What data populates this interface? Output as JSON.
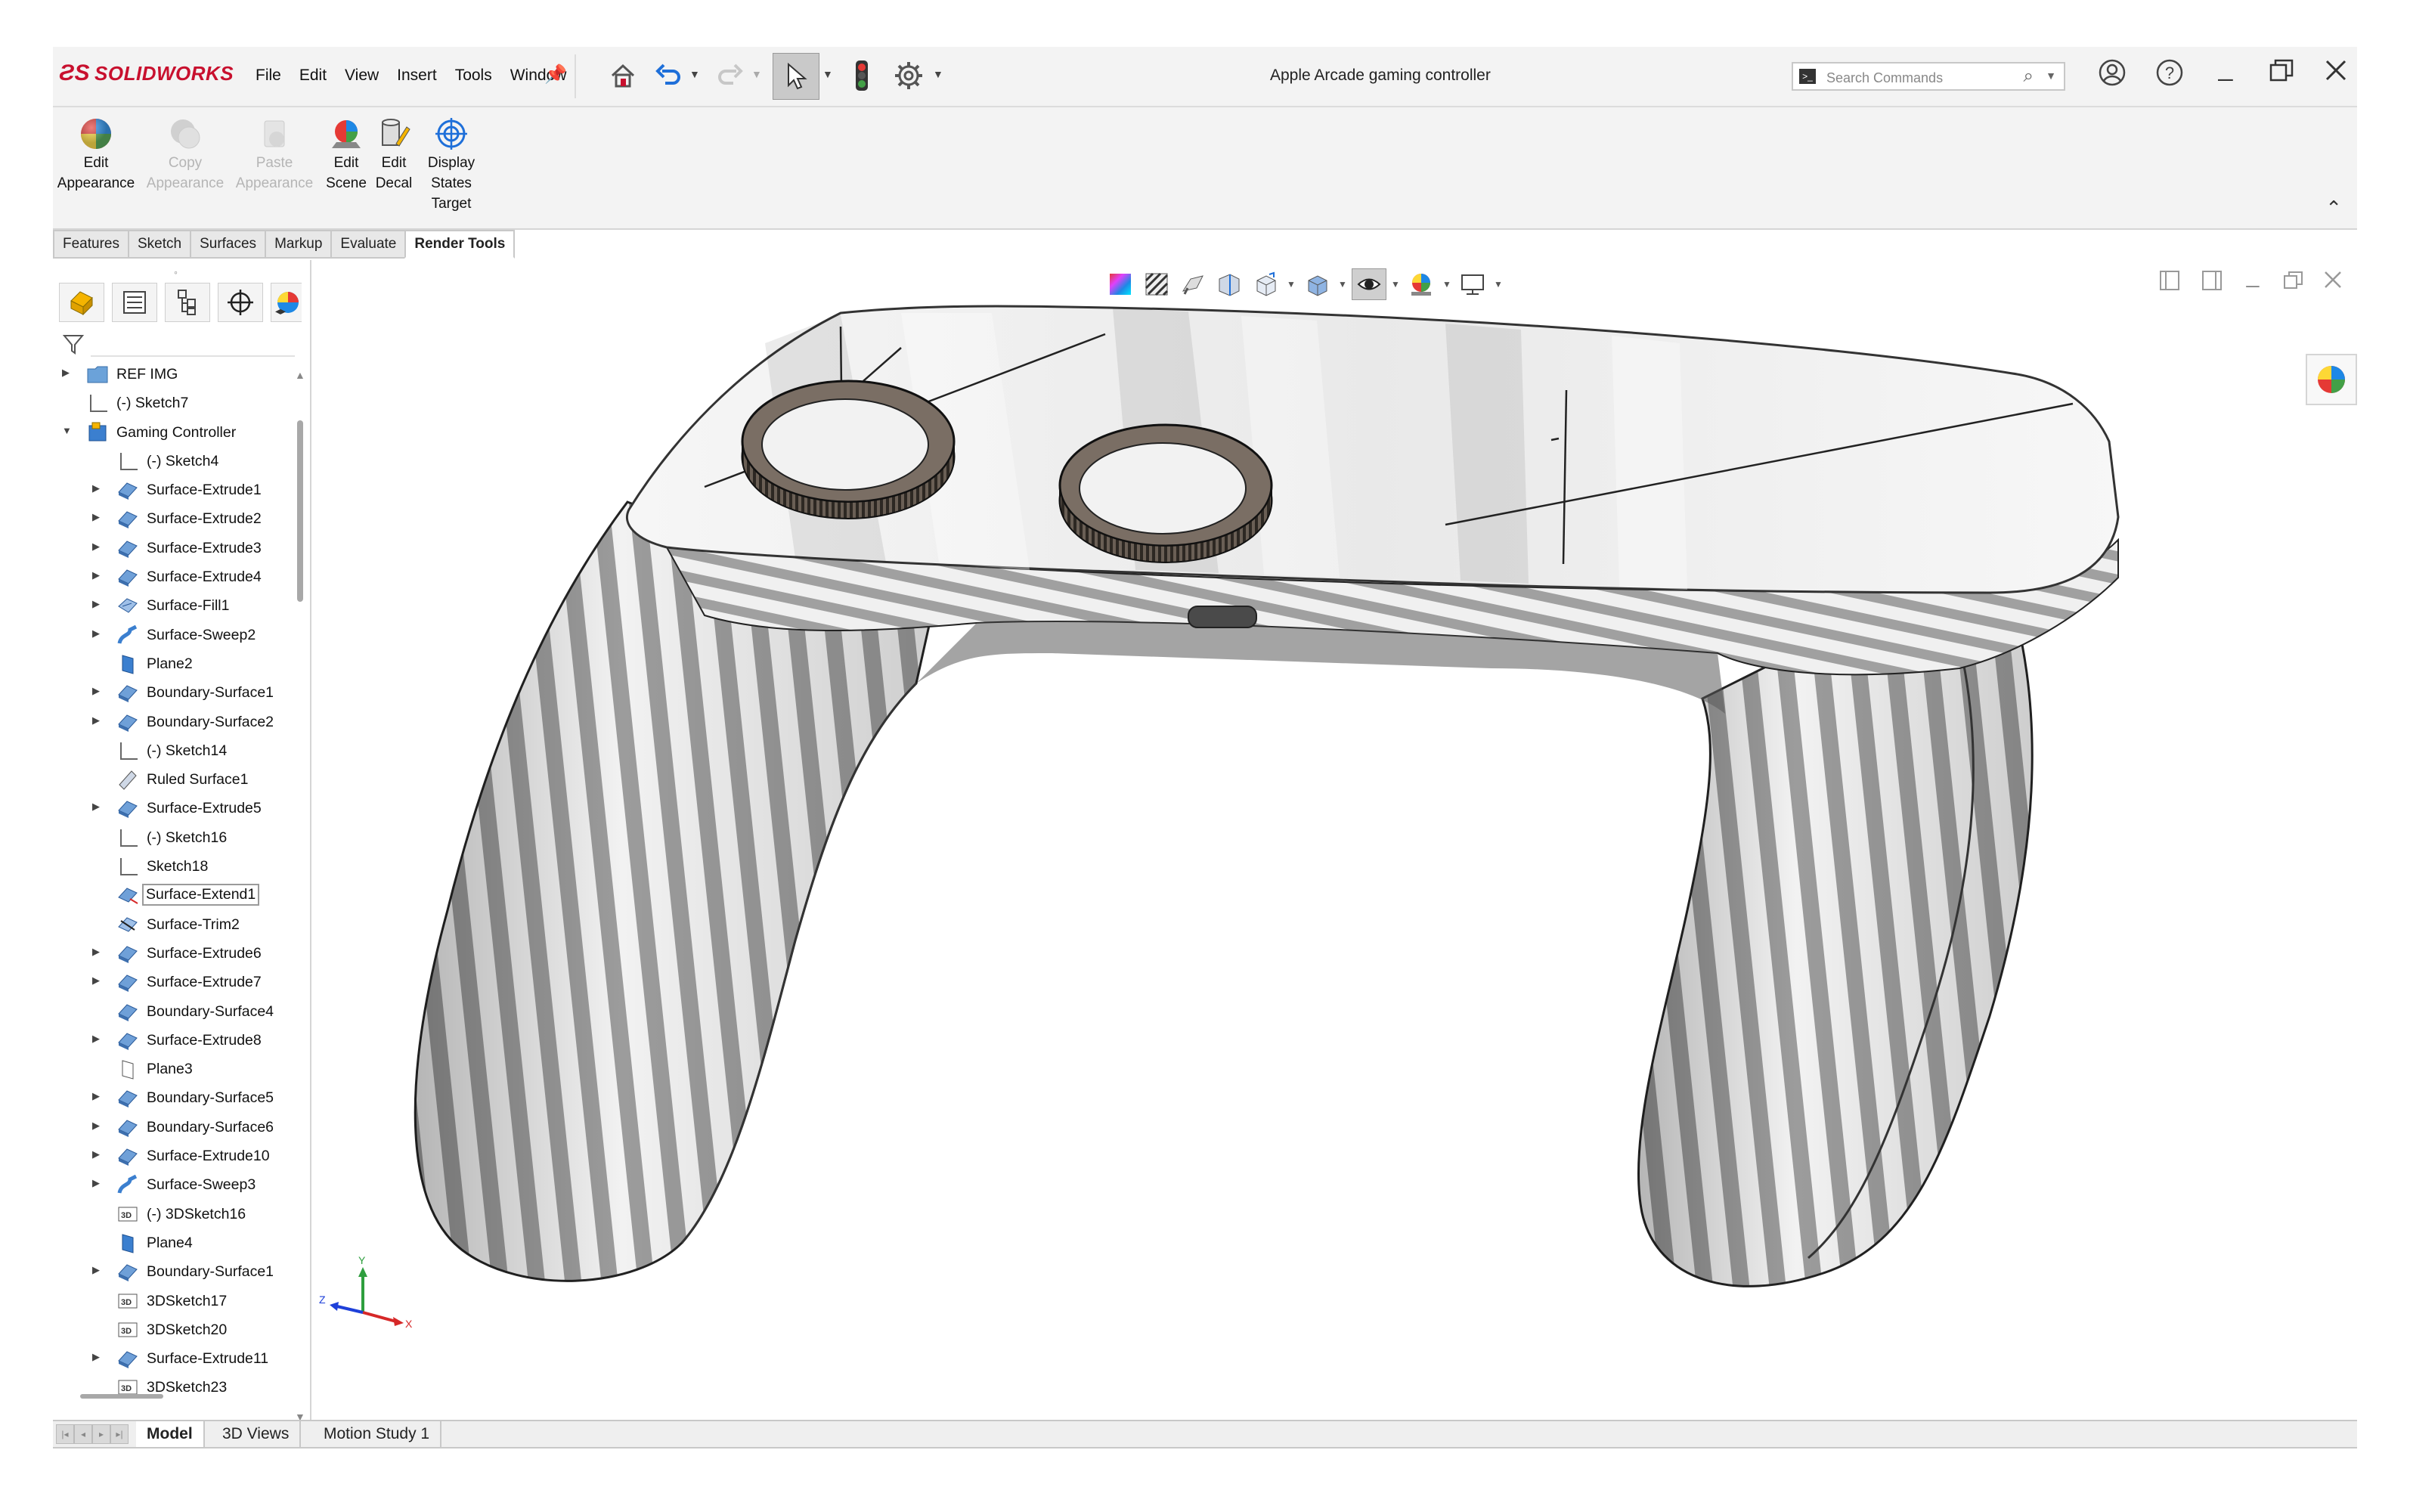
{
  "app": {
    "brand": "SOLIDWORKS",
    "document_title": "Apple Arcade gaming controller"
  },
  "menu": [
    "File",
    "Edit",
    "View",
    "Insert",
    "Tools",
    "Window"
  ],
  "toolbar_icons": [
    "home-icon",
    "undo-icon",
    "redo-icon",
    "select-arrow-icon",
    "traffic-light-icon",
    "gear-icon"
  ],
  "search": {
    "placeholder": "Search Commands"
  },
  "window_controls": [
    "user-icon",
    "help-icon",
    "minimize-icon",
    "restore-icon",
    "close-icon"
  ],
  "ribbon": {
    "buttons": [
      {
        "label": "Edit Appearance",
        "line1": "Edit",
        "line2": "Appearance",
        "enabled": true,
        "icon": "appearance-ball-icon"
      },
      {
        "label": "Copy Appearance",
        "line1": "Copy",
        "line2": "Appearance",
        "enabled": false,
        "icon": "copy-appearance-icon"
      },
      {
        "label": "Paste Appearance",
        "line1": "Paste",
        "line2": "Appearance",
        "enabled": false,
        "icon": "paste-appearance-icon"
      },
      {
        "label": "Edit Scene",
        "line1": "Edit",
        "line2": "Scene",
        "enabled": true,
        "icon": "scene-icon"
      },
      {
        "label": "Edit Decal",
        "line1": "Edit",
        "line2": "Decal",
        "enabled": true,
        "icon": "decal-icon"
      },
      {
        "label": "Display States Target",
        "line1": "Display",
        "line2": "States",
        "line3": "Target",
        "enabled": true,
        "icon": "target-icon"
      }
    ]
  },
  "command_tabs": [
    "Features",
    "Sketch",
    "Surfaces",
    "Markup",
    "Evaluate",
    "Render Tools"
  ],
  "active_command_tab": "Render Tools",
  "feature_tree": [
    {
      "label": "REF IMG",
      "type": "folder",
      "level": 0,
      "expandable": true
    },
    {
      "label": "(-) Sketch7",
      "type": "sketch",
      "level": 0,
      "expandable": false
    },
    {
      "label": "Gaming Controller",
      "type": "body",
      "level": 0,
      "expandable": true,
      "expanded": true
    },
    {
      "label": "(-) Sketch4",
      "type": "sketch",
      "level": 1,
      "expandable": false
    },
    {
      "label": "Surface-Extrude1",
      "type": "surface",
      "level": 1,
      "expandable": true
    },
    {
      "label": "Surface-Extrude2",
      "type": "surface",
      "level": 1,
      "expandable": true
    },
    {
      "label": "Surface-Extrude3",
      "type": "surface",
      "level": 1,
      "expandable": true
    },
    {
      "label": "Surface-Extrude4",
      "type": "surface",
      "level": 1,
      "expandable": true
    },
    {
      "label": "Surface-Fill1",
      "type": "fill",
      "level": 1,
      "expandable": true
    },
    {
      "label": "Surface-Sweep2",
      "type": "sweep",
      "level": 1,
      "expandable": true
    },
    {
      "label": "Plane2",
      "type": "plane",
      "level": 1,
      "expandable": false
    },
    {
      "label": "Boundary-Surface1",
      "type": "surface",
      "level": 1,
      "expandable": true
    },
    {
      "label": "Boundary-Surface2",
      "type": "surface",
      "level": 1,
      "expandable": true
    },
    {
      "label": "(-) Sketch14",
      "type": "sketch",
      "level": 1,
      "expandable": false
    },
    {
      "label": "Ruled Surface1",
      "type": "ruled",
      "level": 1,
      "expandable": false
    },
    {
      "label": "Surface-Extrude5",
      "type": "surface",
      "level": 1,
      "expandable": true
    },
    {
      "label": "(-) Sketch16",
      "type": "sketch",
      "level": 1,
      "expandable": false
    },
    {
      "label": "Sketch18",
      "type": "sketch",
      "level": 1,
      "expandable": false
    },
    {
      "label": "Surface-Extend1",
      "type": "extend",
      "level": 1,
      "expandable": false,
      "selected": true
    },
    {
      "label": "Surface-Trim2",
      "type": "trim",
      "level": 1,
      "expandable": false
    },
    {
      "label": "Surface-Extrude6",
      "type": "surface",
      "level": 1,
      "expandable": true
    },
    {
      "label": "Surface-Extrude7",
      "type": "surface",
      "level": 1,
      "expandable": true
    },
    {
      "label": "Boundary-Surface4",
      "type": "surface",
      "level": 1,
      "expandable": false
    },
    {
      "label": "Surface-Extrude8",
      "type": "surface",
      "level": 1,
      "expandable": true
    },
    {
      "label": "Plane3",
      "type": "plane-outline",
      "level": 1,
      "expandable": false
    },
    {
      "label": "Boundary-Surface5",
      "type": "surface",
      "level": 1,
      "expandable": true
    },
    {
      "label": "Boundary-Surface6",
      "type": "surface",
      "level": 1,
      "expandable": true
    },
    {
      "label": "Surface-Extrude10",
      "type": "surface",
      "level": 1,
      "expandable": true
    },
    {
      "label": "Surface-Sweep3",
      "type": "sweep",
      "level": 1,
      "expandable": true
    },
    {
      "label": "(-) 3DSketch16",
      "type": "3dsketch",
      "level": 1,
      "expandable": false
    },
    {
      "label": "Plane4",
      "type": "plane",
      "level": 1,
      "expandable": false
    },
    {
      "label": "Boundary-Surface1",
      "type": "surface",
      "level": 1,
      "expandable": true
    },
    {
      "label": "3DSketch17",
      "type": "3dsketch",
      "level": 1,
      "expandable": false
    },
    {
      "label": "3DSketch20",
      "type": "3dsketch",
      "level": 1,
      "expandable": false
    },
    {
      "label": "Surface-Extrude11",
      "type": "surface",
      "level": 1,
      "expandable": true
    },
    {
      "label": "3DSketch23",
      "type": "3dsketch",
      "level": 1,
      "expandable": false
    }
  ],
  "heads_up_icons": [
    "zebra-color-icon",
    "zebra-stripes-icon",
    "curvature-icon",
    "section-view-icon",
    "view-orientation-icon",
    "display-style-icon",
    "hide-show-icon",
    "edit-appearance-icon",
    "apply-scene-icon",
    "view-settings-icon"
  ],
  "triad": {
    "y": "Y",
    "z": "Z",
    "x": "X"
  },
  "bottom_tabs": [
    "Model",
    "3D Views",
    "Motion Study 1"
  ],
  "active_bottom_tab": "Model",
  "colors": {
    "brand_red": "#c8102e",
    "accent_blue": "#1e6fd9",
    "panel_bg": "#f3f3f3"
  }
}
